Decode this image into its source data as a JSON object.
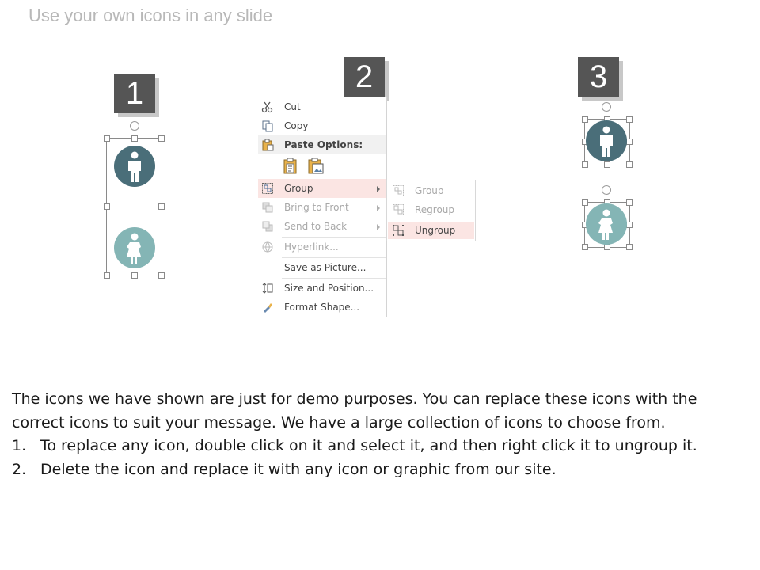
{
  "slide": {
    "title": "Use your own icons in any slide",
    "steps": [
      "1",
      "2",
      "3"
    ]
  },
  "colors": {
    "dark_icon": "#4a6e79",
    "light_icon": "#84b5b5",
    "step_badge": "#555555",
    "menu_highlight": "#fbe5e3"
  },
  "context_menu": {
    "items": [
      {
        "label": "Cut",
        "icon": "scissors-icon",
        "disabled": false
      },
      {
        "label": "Copy",
        "icon": "copy-icon",
        "disabled": false
      },
      {
        "label": "Paste Options:",
        "icon": "clipboard-icon",
        "disabled": false
      },
      {
        "label": "Group",
        "icon": "group-icon",
        "disabled": false,
        "highlighted": true,
        "submenu": true
      },
      {
        "label": "Bring to Front",
        "icon": "bring-to-front-icon",
        "disabled": true,
        "submenu": true
      },
      {
        "label": "Send to Back",
        "icon": "send-to-back-icon",
        "disabled": true,
        "submenu": true
      },
      {
        "label": "Hyperlink...",
        "icon": "hyperlink-icon",
        "disabled": true
      },
      {
        "label": "Save as Picture...",
        "icon": "",
        "disabled": false
      },
      {
        "label": "Size and Position...",
        "icon": "size-position-icon",
        "disabled": false
      },
      {
        "label": "Format Shape...",
        "icon": "format-shape-icon",
        "disabled": false
      }
    ]
  },
  "submenu": {
    "items": [
      {
        "label": "Group",
        "disabled": true
      },
      {
        "label": "Regroup",
        "disabled": true
      },
      {
        "label": "Ungroup",
        "disabled": false,
        "highlighted": true
      }
    ]
  },
  "description": {
    "intro": "The icons we have shown are just for demo purposes. You can replace these icons with the correct icons to suit your message. We have a large collection of icons to choose from.",
    "steps": [
      {
        "num": "1.",
        "text": "To replace any icon, double click on it and select it, and then right click it to ungroup it."
      },
      {
        "num": "2.",
        "text": "Delete the icon and replace it with any icon or graphic from our site."
      }
    ]
  }
}
